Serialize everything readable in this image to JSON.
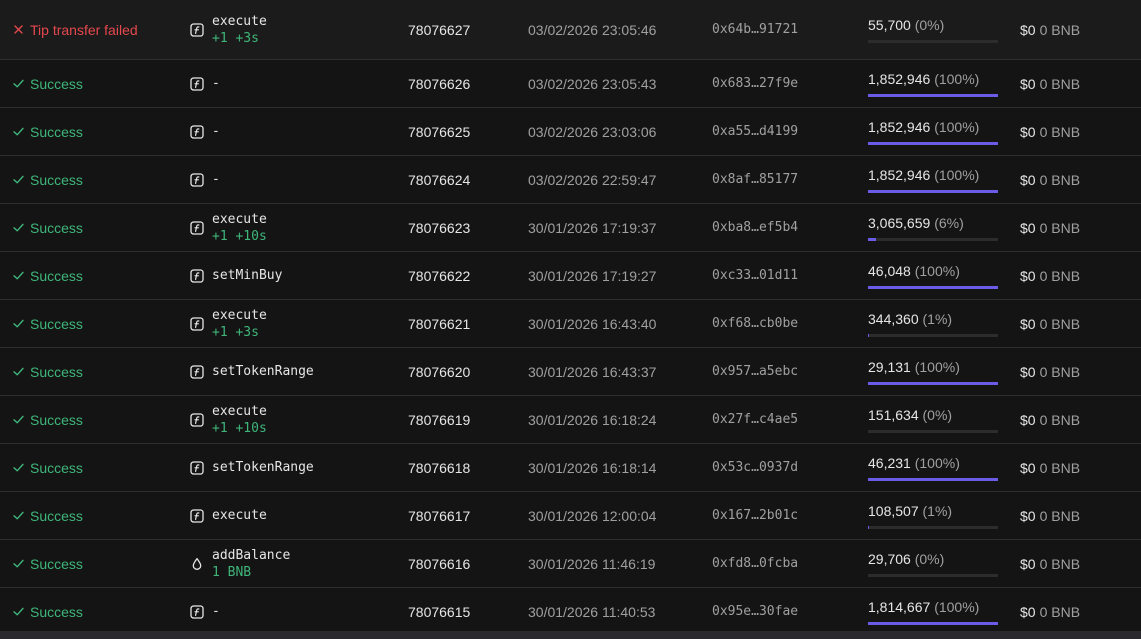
{
  "rows": [
    {
      "status": "Tip transfer failed",
      "status_kind": "fail",
      "method_icon": "function-icon",
      "method": "execute",
      "method_sub": "+1 +3s",
      "block": "78076627",
      "time": "03/02/2026 23:05:46",
      "hash": "0x64b…91721",
      "gas_used": "55,700",
      "gas_pct": "(0%)",
      "gas_fill": 0,
      "fee_usd": "$0",
      "fee_bnb": "0 BNB"
    },
    {
      "status": "Success",
      "status_kind": "ok",
      "method_icon": "function-icon",
      "method": "-",
      "method_sub": "",
      "block": "78076626",
      "time": "03/02/2026 23:05:43",
      "hash": "0x683…27f9e",
      "gas_used": "1,852,946",
      "gas_pct": "(100%)",
      "gas_fill": 100,
      "fee_usd": "$0",
      "fee_bnb": "0 BNB"
    },
    {
      "status": "Success",
      "status_kind": "ok",
      "method_icon": "function-icon",
      "method": "-",
      "method_sub": "",
      "block": "78076625",
      "time": "03/02/2026 23:03:06",
      "hash": "0xa55…d4199",
      "gas_used": "1,852,946",
      "gas_pct": "(100%)",
      "gas_fill": 100,
      "fee_usd": "$0",
      "fee_bnb": "0 BNB"
    },
    {
      "status": "Success",
      "status_kind": "ok",
      "method_icon": "function-icon",
      "method": "-",
      "method_sub": "",
      "block": "78076624",
      "time": "03/02/2026 22:59:47",
      "hash": "0x8af…85177",
      "gas_used": "1,852,946",
      "gas_pct": "(100%)",
      "gas_fill": 100,
      "fee_usd": "$0",
      "fee_bnb": "0 BNB"
    },
    {
      "status": "Success",
      "status_kind": "ok",
      "method_icon": "function-icon",
      "method": "execute",
      "method_sub": "+1 +10s",
      "block": "78076623",
      "time": "30/01/2026 17:19:37",
      "hash": "0xba8…ef5b4",
      "gas_used": "3,065,659",
      "gas_pct": "(6%)",
      "gas_fill": 6,
      "fee_usd": "$0",
      "fee_bnb": "0 BNB"
    },
    {
      "status": "Success",
      "status_kind": "ok",
      "method_icon": "function-icon",
      "method": "setMinBuy",
      "method_sub": "",
      "block": "78076622",
      "time": "30/01/2026 17:19:27",
      "hash": "0xc33…01d11",
      "gas_used": "46,048",
      "gas_pct": "(100%)",
      "gas_fill": 100,
      "fee_usd": "$0",
      "fee_bnb": "0 BNB"
    },
    {
      "status": "Success",
      "status_kind": "ok",
      "method_icon": "function-icon",
      "method": "execute",
      "method_sub": "+1 +3s",
      "block": "78076621",
      "time": "30/01/2026 16:43:40",
      "hash": "0xf68…cb0be",
      "gas_used": "344,360",
      "gas_pct": "(1%)",
      "gas_fill": 1,
      "fee_usd": "$0",
      "fee_bnb": "0 BNB"
    },
    {
      "status": "Success",
      "status_kind": "ok",
      "method_icon": "function-icon",
      "method": "setTokenRange",
      "method_sub": "",
      "block": "78076620",
      "time": "30/01/2026 16:43:37",
      "hash": "0x957…a5ebc",
      "gas_used": "29,131",
      "gas_pct": "(100%)",
      "gas_fill": 100,
      "fee_usd": "$0",
      "fee_bnb": "0 BNB"
    },
    {
      "status": "Success",
      "status_kind": "ok",
      "method_icon": "function-icon",
      "method": "execute",
      "method_sub": "+1 +10s",
      "block": "78076619",
      "time": "30/01/2026 16:18:24",
      "hash": "0x27f…c4ae5",
      "gas_used": "151,634",
      "gas_pct": "(0%)",
      "gas_fill": 0,
      "fee_usd": "$0",
      "fee_bnb": "0 BNB"
    },
    {
      "status": "Success",
      "status_kind": "ok",
      "method_icon": "function-icon",
      "method": "setTokenRange",
      "method_sub": "",
      "block": "78076618",
      "time": "30/01/2026 16:18:14",
      "hash": "0x53c…0937d",
      "gas_used": "46,231",
      "gas_pct": "(100%)",
      "gas_fill": 100,
      "fee_usd": "$0",
      "fee_bnb": "0 BNB"
    },
    {
      "status": "Success",
      "status_kind": "ok",
      "method_icon": "function-icon",
      "method": "execute",
      "method_sub": "",
      "block": "78076617",
      "time": "30/01/2026 12:00:04",
      "hash": "0x167…2b01c",
      "gas_used": "108,507",
      "gas_pct": "(1%)",
      "gas_fill": 1,
      "fee_usd": "$0",
      "fee_bnb": "0 BNB"
    },
    {
      "status": "Success",
      "status_kind": "ok",
      "method_icon": "drop-icon",
      "method": "addBalance",
      "method_sub": "1 BNB",
      "block": "78076616",
      "time": "30/01/2026 11:46:19",
      "hash": "0xfd8…0fcba",
      "gas_used": "29,706",
      "gas_pct": "(0%)",
      "gas_fill": 0,
      "fee_usd": "$0",
      "fee_bnb": "0 BNB"
    },
    {
      "status": "Success",
      "status_kind": "ok",
      "method_icon": "function-icon",
      "method": "-",
      "method_sub": "",
      "block": "78076615",
      "time": "30/01/2026 11:40:53",
      "hash": "0x95e…30fae",
      "gas_used": "1,814,667",
      "gas_pct": "(100%)",
      "gas_fill": 100,
      "fee_usd": "$0",
      "fee_bnb": "0 BNB"
    }
  ],
  "colors": {
    "success": "#3fb57a",
    "fail": "#e5484d",
    "gas_fill": "#6b5ce7",
    "gas_track": "#2c2c2c"
  }
}
